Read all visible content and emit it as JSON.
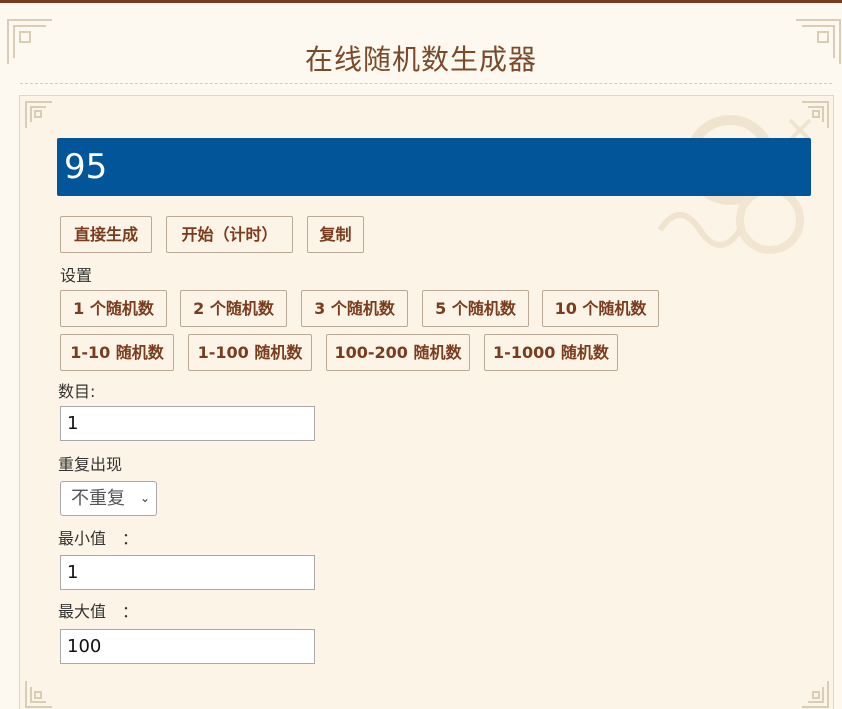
{
  "header": {
    "title": "在线随机数生成器"
  },
  "result": {
    "value": "95"
  },
  "actions": {
    "generate": "直接生成",
    "start_timed": "开始（计时）",
    "copy": "复制"
  },
  "settings": {
    "title": "设置",
    "count_presets": [
      "1 个随机数",
      "2 个随机数",
      "3 个随机数",
      "5 个随机数",
      "10 个随机数"
    ],
    "range_presets": [
      "1-10 随机数",
      "1-100 随机数",
      "100-200 随机数",
      "1-1000 随机数"
    ]
  },
  "form": {
    "count_label": "数目:",
    "count_value": "1",
    "repeat_label": "重复出现",
    "repeat_value": "不重复",
    "min_label": "最小值　：",
    "min_value": "1",
    "max_label": "最大值　：",
    "max_value": "100"
  },
  "colors": {
    "accent": "#03559a",
    "button_text": "#7a3c1e",
    "background": "#fcf4e6"
  }
}
